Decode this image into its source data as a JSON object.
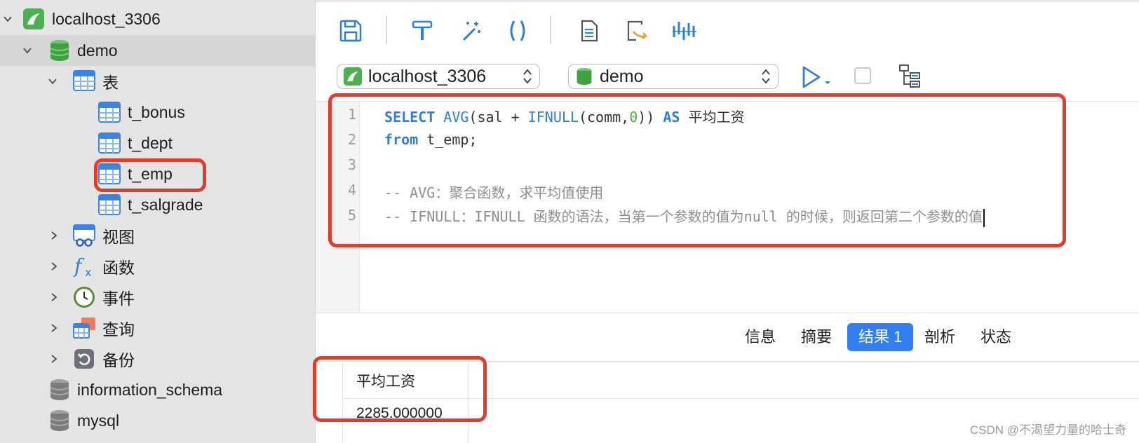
{
  "sidebar": {
    "connection": "localhost_3306",
    "database": "demo",
    "tables_group": "表",
    "tables": [
      "t_bonus",
      "t_dept",
      "t_emp",
      "t_salgrade"
    ],
    "groups": [
      "视图",
      "函数",
      "事件",
      "查询",
      "备份"
    ],
    "other_databases": [
      "information_schema",
      "mysql"
    ]
  },
  "selectors": {
    "connection": "localhost_3306",
    "database": "demo"
  },
  "editor": {
    "line_numbers": [
      "1",
      "2",
      "3",
      "4",
      "5"
    ],
    "line1": {
      "kw1": "SELECT",
      "fn1": "AVG",
      "t1": "(sal + ",
      "fn2": "IFNULL",
      "t2": "(comm,",
      "num": "0",
      "t3": ")) ",
      "kw2": "AS",
      "t4": " 平均工资"
    },
    "line2": {
      "kw": "from",
      "rest": " t_emp;"
    },
    "line4": "-- AVG：聚合函数，求平均值使用",
    "line5": "-- IFNULL：IFNULL 函数的语法，当第一个参数的值为null 的时候，则返回第二个参数的值"
  },
  "result_tabs": [
    "信息",
    "摘要",
    "结果 1",
    "剖析",
    "状态"
  ],
  "active_tab": "结果 1",
  "result": {
    "column": "平均工资",
    "value": "2285.000000"
  },
  "watermark": "CSDN @不渴望力量的哈士奇",
  "colors": {
    "accent": "#2f7ff0",
    "highlight_box": "#e23c2a",
    "keyword": "#2e7fd6",
    "number": "#4bb04b",
    "comment": "#8e8e8e"
  }
}
